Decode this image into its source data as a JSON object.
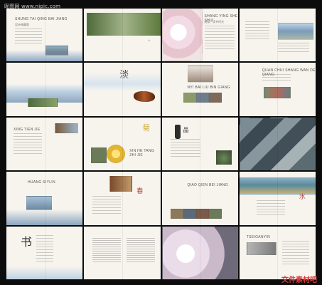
{
  "watermark": "昵图网 www.nipic.com",
  "bottom_stamp": "文件素材吧",
  "spreads": [
    {
      "id": "cover",
      "title": "SHUNG TAI QING BAI JIANG",
      "subtitle": "设计精美版",
      "caption": "精美书页",
      "accent": "#6a8fb5"
    },
    {
      "id": "garden",
      "title": "",
      "subtitle": "",
      "caption": "",
      "accent": "#5b7a4a"
    },
    {
      "id": "blossom",
      "title": "SHANG YING SHE SHUI",
      "subtitle": "阅读 · 读书时光",
      "caption": "",
      "accent": "#d9b7c3"
    },
    {
      "id": "lake",
      "title": "",
      "subtitle": "",
      "caption": "",
      "accent": "#8aa6c2"
    },
    {
      "id": "mountain",
      "title": "",
      "subtitle": "",
      "caption": "",
      "accent": "#90a9bf"
    },
    {
      "id": "violin",
      "title": "",
      "subtitle": "",
      "caption": "",
      "accent": "#8b4a2b"
    },
    {
      "id": "architecture",
      "title": "NYI BAI LIU BIN GIANG",
      "subtitle": "",
      "caption": "",
      "accent": "#5a5a5a"
    },
    {
      "id": "market",
      "title": "QUAN CHUI SHANG WAN DE QIANG",
      "subtitle": "",
      "caption": "",
      "accent": "#9c4b3e"
    },
    {
      "id": "garden2",
      "title": "XING TIEN JIE",
      "subtitle": "",
      "caption": "",
      "accent": "#6e8a5a"
    },
    {
      "id": "chrysanthemum",
      "title": "XIN HE TANG ZHI JIE",
      "subtitle": "",
      "caption": "",
      "accent": "#e2b630"
    },
    {
      "id": "bottle",
      "title": "",
      "subtitle": "",
      "caption": "",
      "accent": "#2d2d2d"
    },
    {
      "id": "rooftops",
      "title": "",
      "subtitle": "",
      "caption": "",
      "accent": "#44535e"
    },
    {
      "id": "bridge",
      "title": "HUANG SIYLIN",
      "subtitle": "",
      "caption": "",
      "accent": "#7d93a7"
    },
    {
      "id": "tea",
      "title": "",
      "subtitle": "",
      "caption": "",
      "accent": "#a1422b"
    },
    {
      "id": "heritage",
      "title": "QIAO QIEN BEI JIANG",
      "subtitle": "",
      "caption": "",
      "accent": "#7a5b3b"
    },
    {
      "id": "waterfront",
      "title": "",
      "subtitle": "",
      "caption": "",
      "accent": "#4a8a9b"
    },
    {
      "id": "brushcover",
      "title": "书",
      "subtitle": "",
      "caption": "",
      "accent": "#3a3a3a"
    },
    {
      "id": "tables",
      "title": "",
      "subtitle": "",
      "caption": "",
      "accent": "#3b4d5e"
    },
    {
      "id": "blossom2",
      "title": "",
      "subtitle": "",
      "caption": "",
      "accent": "#d7c6d4"
    },
    {
      "id": "final",
      "title": "TSEIGANYIN",
      "subtitle": "",
      "caption": "",
      "accent": "#888888"
    }
  ]
}
